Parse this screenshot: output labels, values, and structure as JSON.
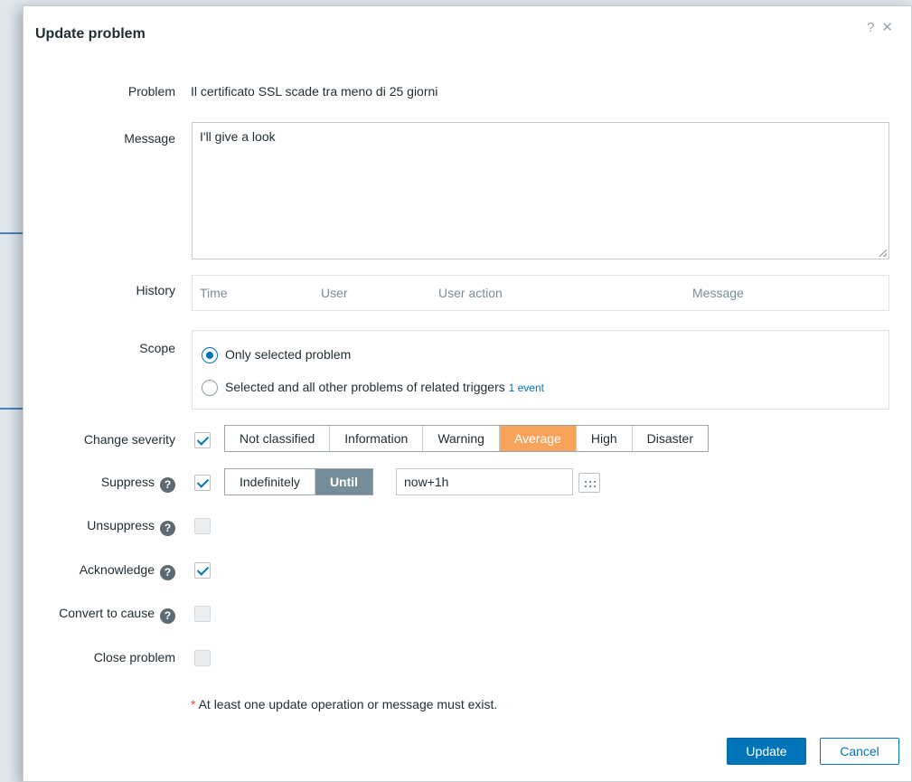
{
  "dialog": {
    "title": "Update problem",
    "help_glyph": "?",
    "close_glyph": "✕"
  },
  "problem": {
    "label": "Problem",
    "value": "Il certificato SSL scade tra meno di 25 giorni"
  },
  "message": {
    "label": "Message",
    "value": "I'll give a look"
  },
  "history": {
    "label": "History",
    "columns": [
      "Time",
      "User",
      "User action",
      "Message"
    ]
  },
  "scope": {
    "label": "Scope",
    "options": [
      {
        "label": "Only selected problem",
        "selected": true
      },
      {
        "label": "Selected and all other problems of related triggers",
        "selected": false
      }
    ],
    "event_link": "1 event"
  },
  "change_severity": {
    "label": "Change severity",
    "checked": true,
    "levels": [
      "Not classified",
      "Information",
      "Warning",
      "Average",
      "High",
      "Disaster"
    ],
    "selected": "Average"
  },
  "suppress": {
    "label": "Suppress",
    "checked": true,
    "modes": [
      "Indefinitely",
      "Until"
    ],
    "selected_mode": "Until",
    "until_value": "now+1h"
  },
  "unsuppress": {
    "label": "Unsuppress",
    "checked": false
  },
  "acknowledge": {
    "label": "Acknowledge",
    "checked": true
  },
  "convert_to_cause": {
    "label": "Convert to cause",
    "checked": false
  },
  "close_problem": {
    "label": "Close problem",
    "checked": false
  },
  "help_icon_glyph": "?",
  "note": {
    "star": "*",
    "text": " At least one update operation or message must exist."
  },
  "buttons": {
    "update": "Update",
    "cancel": "Cancel"
  },
  "colors": {
    "primary": "#0275b8",
    "severity_average": "#f7a35c",
    "segment_active_gray": "#768d99"
  }
}
